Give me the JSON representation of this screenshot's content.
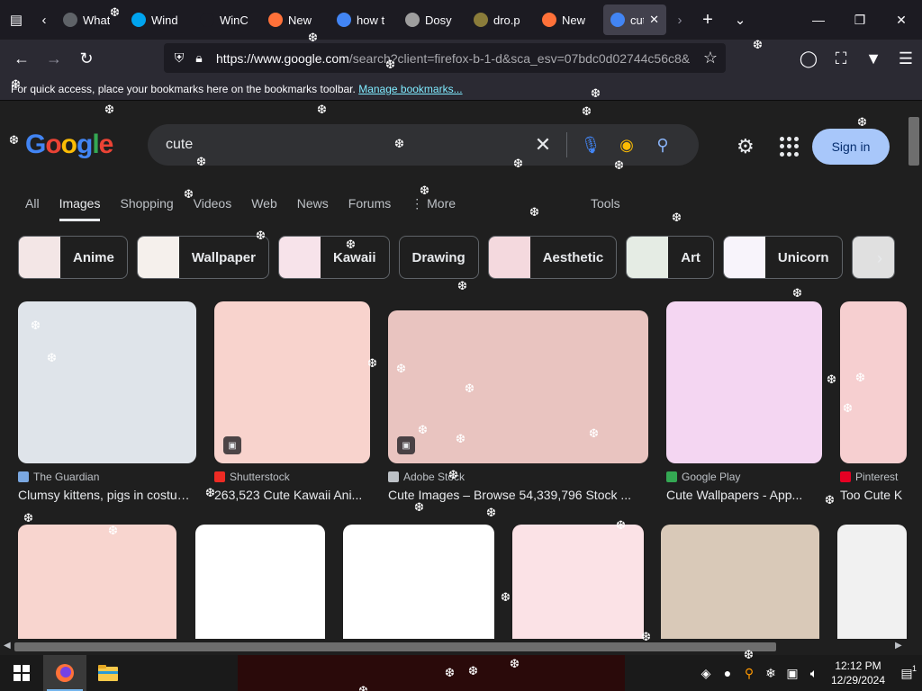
{
  "browser": {
    "tabs": [
      {
        "label": "What",
        "favicon_color": "#5f6368"
      },
      {
        "label": "Wind",
        "favicon_color": "#00a4ef"
      },
      {
        "label": "WinC",
        "favicon_color": "#1c1b22"
      },
      {
        "label": "New",
        "favicon_color": "#ff7139"
      },
      {
        "label": "how t",
        "favicon_color": "#4285f4"
      },
      {
        "label": "Dosy",
        "favicon_color": "#9e9e9e"
      },
      {
        "label": "dro.p",
        "favicon_color": "#8a7c3a"
      },
      {
        "label": "New",
        "favicon_color": "#ff7139"
      },
      {
        "label": "cut",
        "favicon_color": "#4285f4"
      }
    ],
    "url": "https://www.google.com/search?client=firefox-b-1-d&sca_esv=07bdc0d02744c56c8&",
    "url_domain": "https://www.google.com",
    "url_rest": "/search?client=firefox-b-1-d&sca_esv=07bdc0d02744c56c8&",
    "bookmarks_text": "For quick access, place your bookmarks here on the bookmarks toolbar.",
    "bookmarks_link": "Manage bookmarks..."
  },
  "google": {
    "logo": "Google",
    "query": "cute",
    "signin": "Sign in",
    "scopes": [
      "All",
      "Images",
      "Shopping",
      "Videos",
      "Web",
      "News",
      "Forums",
      "More"
    ],
    "active_scope": "Images",
    "tools": "Tools",
    "chips": [
      {
        "label": "Anime",
        "color": "#f3e6e6"
      },
      {
        "label": "Wallpaper",
        "color": "#f5f0ec"
      },
      {
        "label": "Kawaii",
        "color": "#f7e3ea"
      },
      {
        "label": "Drawing",
        "color": ""
      },
      {
        "label": "Aesthetic",
        "color": "#f4d9de"
      },
      {
        "label": "Art",
        "color": "#e5ece4"
      },
      {
        "label": "Unicorn",
        "color": "#f8f4fb"
      },
      {
        "label": "",
        "color": "#e0e0e0"
      }
    ],
    "results_row1": [
      {
        "source": "The Guardian",
        "title": "Clumsy kittens, pigs in costume ...",
        "color": "#dfe4ea",
        "icon_color": "#7aa7e0",
        "badge": false
      },
      {
        "source": "Shutterstock",
        "title": "263,523 Cute Kawaii Ani...",
        "color": "#f8d3cd",
        "icon_color": "#ee2b24",
        "badge": true
      },
      {
        "source": "Adobe Stock",
        "title": "Cute Images – Browse 54,339,796 Stock ...",
        "color": "#e9c4c0",
        "icon_color": "#bdc1c6",
        "badge": true
      },
      {
        "source": "Google Play",
        "title": "Cute Wallpapers - App...",
        "color": "#f4d6f2",
        "icon_color": "#34a853",
        "badge": false
      },
      {
        "source": "Pinterest",
        "title": "Too Cute K",
        "color": "#f6cfd0",
        "icon_color": "#e60023",
        "badge": false
      }
    ],
    "results_row2": [
      {
        "color": "#f8d5cf"
      },
      {
        "color": "#ffffff"
      },
      {
        "color": "#ffffff"
      },
      {
        "color": "#fbe2e6"
      },
      {
        "color": "#d9c9b8"
      },
      {
        "color": "#f1f1f1"
      }
    ]
  },
  "taskbar": {
    "time": "12:12 PM",
    "date": "12/29/2024",
    "notification_count": "1"
  }
}
